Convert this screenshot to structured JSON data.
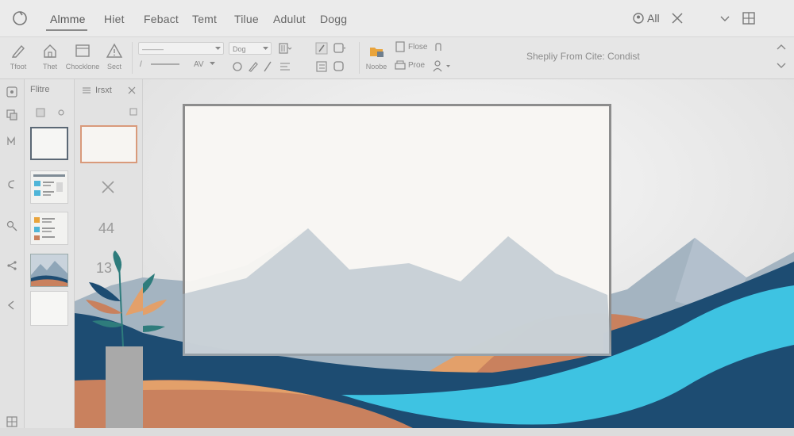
{
  "tabs": [
    {
      "label": "Almme",
      "active": true
    },
    {
      "label": "Hiet"
    },
    {
      "label": "Febact"
    },
    {
      "label": "Temt"
    },
    {
      "label": "Tilue"
    },
    {
      "label": "Adulut"
    },
    {
      "label": "Dogg"
    }
  ],
  "topbar": {
    "account_label": "All"
  },
  "ribbon": {
    "buttons": [
      {
        "label": "Tfoot"
      },
      {
        "label": "Thet"
      },
      {
        "label": "Chocklone"
      },
      {
        "label": "Sect"
      }
    ],
    "font_size_value": "Dog",
    "font_style_value": "AV",
    "paste_label": "Noobe",
    "file_label": "Flose",
    "print_label": "Proe",
    "caption": "Shepliy From Cite: Condist"
  },
  "slides_panel": {
    "title": "Flitre"
  },
  "notes_panel": {
    "title": "Irsxt",
    "numbers": [
      "44",
      "13"
    ]
  },
  "colors": {
    "mountain": "#a4b4c1",
    "navy": "#1d4c72",
    "cyan": "#3ec3e2",
    "orange": "#e3a06a",
    "terracotta": "#c9815e",
    "leaf": "#2e7c7c"
  }
}
